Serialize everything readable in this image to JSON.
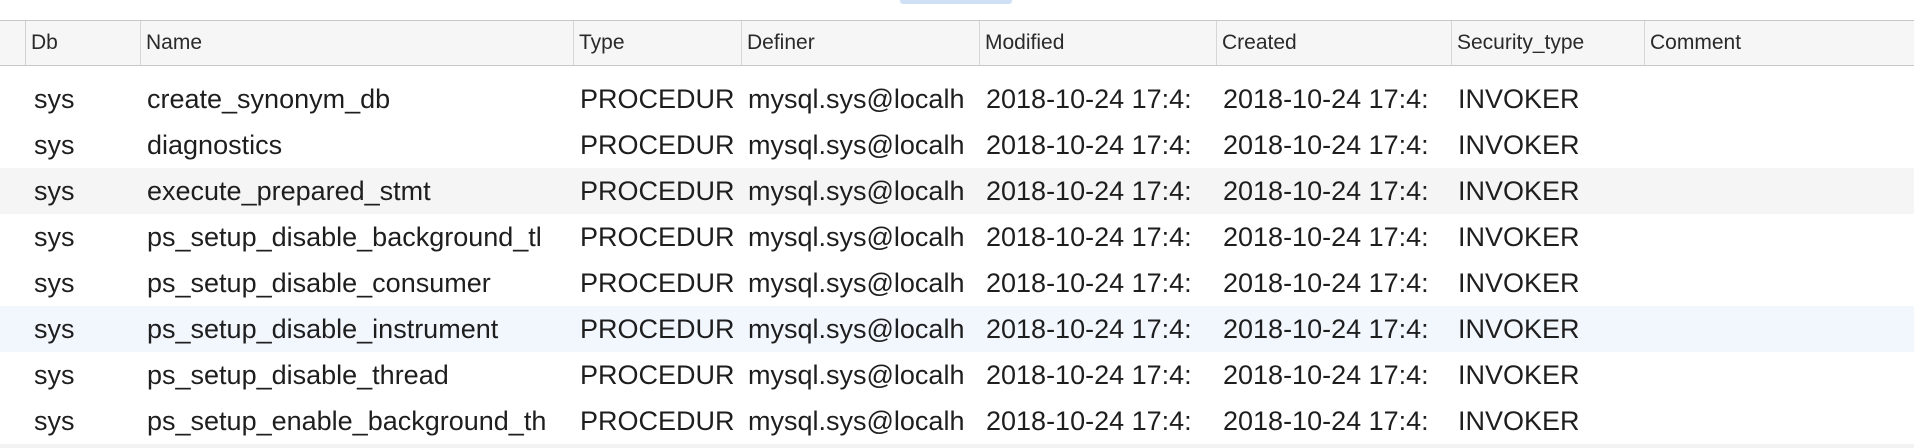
{
  "table": {
    "columns": [
      "Db",
      "Name",
      "Type",
      "Definer",
      "Modified",
      "Created",
      "Security_type",
      "Comment"
    ],
    "rows": [
      {
        "db": "sys",
        "name": "create_synonym_db",
        "type": "PROCEDUR",
        "definer": "mysql.sys@localh",
        "modified": "2018-10-24 17:4:",
        "created": "2018-10-24 17:4:",
        "security_type": "INVOKER",
        "comment": ""
      },
      {
        "db": "sys",
        "name": "diagnostics",
        "type": "PROCEDUR",
        "definer": "mysql.sys@localh",
        "modified": "2018-10-24 17:4:",
        "created": "2018-10-24 17:4:",
        "security_type": "INVOKER",
        "comment": ""
      },
      {
        "db": "sys",
        "name": "execute_prepared_stmt",
        "type": "PROCEDUR",
        "definer": "mysql.sys@localh",
        "modified": "2018-10-24 17:4:",
        "created": "2018-10-24 17:4:",
        "security_type": "INVOKER",
        "comment": ""
      },
      {
        "db": "sys",
        "name": "ps_setup_disable_background_tl",
        "type": "PROCEDUR",
        "definer": "mysql.sys@localh",
        "modified": "2018-10-24 17:4:",
        "created": "2018-10-24 17:4:",
        "security_type": "INVOKER",
        "comment": ""
      },
      {
        "db": "sys",
        "name": "ps_setup_disable_consumer",
        "type": "PROCEDUR",
        "definer": "mysql.sys@localh",
        "modified": "2018-10-24 17:4:",
        "created": "2018-10-24 17:4:",
        "security_type": "INVOKER",
        "comment": ""
      },
      {
        "db": "sys",
        "name": "ps_setup_disable_instrument",
        "type": "PROCEDUR",
        "definer": "mysql.sys@localh",
        "modified": "2018-10-24 17:4:",
        "created": "2018-10-24 17:4:",
        "security_type": "INVOKER",
        "comment": ""
      },
      {
        "db": "sys",
        "name": "ps_setup_disable_thread",
        "type": "PROCEDUR",
        "definer": "mysql.sys@localh",
        "modified": "2018-10-24 17:4:",
        "created": "2018-10-24 17:4:",
        "security_type": "INVOKER",
        "comment": ""
      },
      {
        "db": "sys",
        "name": "ps_setup_enable_background_th",
        "type": "PROCEDUR",
        "definer": "mysql.sys@localh",
        "modified": "2018-10-24 17:4:",
        "created": "2018-10-24 17:4:",
        "security_type": "INVOKER",
        "comment": ""
      }
    ]
  },
  "colors": {
    "header_bg": "#f6f6f6",
    "alt_row_bg": "#f5f5f5",
    "selected_row_bg": "#f2f6fd",
    "text": "#1e1e1e"
  }
}
